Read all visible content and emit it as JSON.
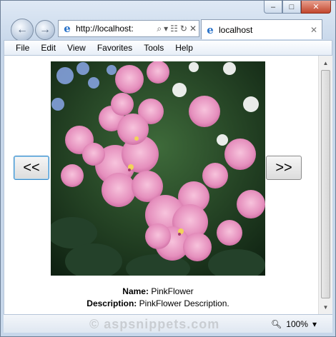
{
  "browser": {
    "address": "http://localhost:",
    "tab_title": "localhost",
    "title_controls": {
      "minimize": "–",
      "maximize": "□",
      "close": "✕"
    },
    "nav": {
      "back_glyph": "←",
      "forward_glyph": "→"
    },
    "address_icons": {
      "search": "⌕",
      "dropdown": "▾",
      "compat": "☷",
      "refresh": "↻",
      "stop": "✕"
    },
    "tab_close": "✕",
    "menu": [
      "File",
      "Edit",
      "View",
      "Favorites",
      "Tools",
      "Help"
    ],
    "zoom": "100%",
    "zoom_dropdown": "▾",
    "scroll_up": "▲",
    "scroll_down": "▼"
  },
  "page": {
    "prev_label": "<<",
    "next_label": ">>",
    "name_label": "Name:",
    "name_value": "PinkFlower",
    "description_label": "Description:",
    "description_value": "PinkFlower Description."
  },
  "watermark": "© aspsnippets.com",
  "colors": {
    "flower": "#e79bc4",
    "leaf": "#24412a",
    "accent": "#3c8bc7"
  }
}
